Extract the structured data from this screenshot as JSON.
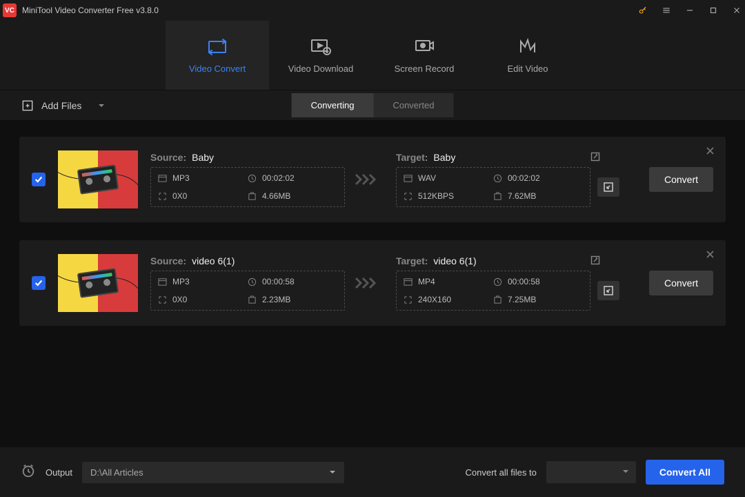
{
  "titlebar": {
    "title": "MiniTool Video Converter Free v3.8.0"
  },
  "main_tabs": {
    "convert": "Video Convert",
    "download": "Video Download",
    "record": "Screen Record",
    "edit": "Edit Video"
  },
  "toolbar": {
    "add_files": "Add Files",
    "seg_converting": "Converting",
    "seg_converted": "Converted"
  },
  "items": [
    {
      "source_label": "Source:",
      "source_name": "Baby",
      "source_format": "MP3",
      "source_duration": "00:02:02",
      "source_res": "0X0",
      "source_size": "4.66MB",
      "target_label": "Target:",
      "target_name": "Baby",
      "target_format": "WAV",
      "target_duration": "00:02:02",
      "target_res": "512KBPS",
      "target_size": "7.62MB",
      "convert": "Convert"
    },
    {
      "source_label": "Source:",
      "source_name": "video 6(1)",
      "source_format": "MP3",
      "source_duration": "00:00:58",
      "source_res": "0X0",
      "source_size": "2.23MB",
      "target_label": "Target:",
      "target_name": "video 6(1)",
      "target_format": "MP4",
      "target_duration": "00:00:58",
      "target_res": "240X160",
      "target_size": "7.25MB",
      "convert": "Convert"
    }
  ],
  "footer": {
    "output_label": "Output",
    "output_path": "D:\\All Articles",
    "convert_to_label": "Convert all files to",
    "convert_all": "Convert All"
  }
}
